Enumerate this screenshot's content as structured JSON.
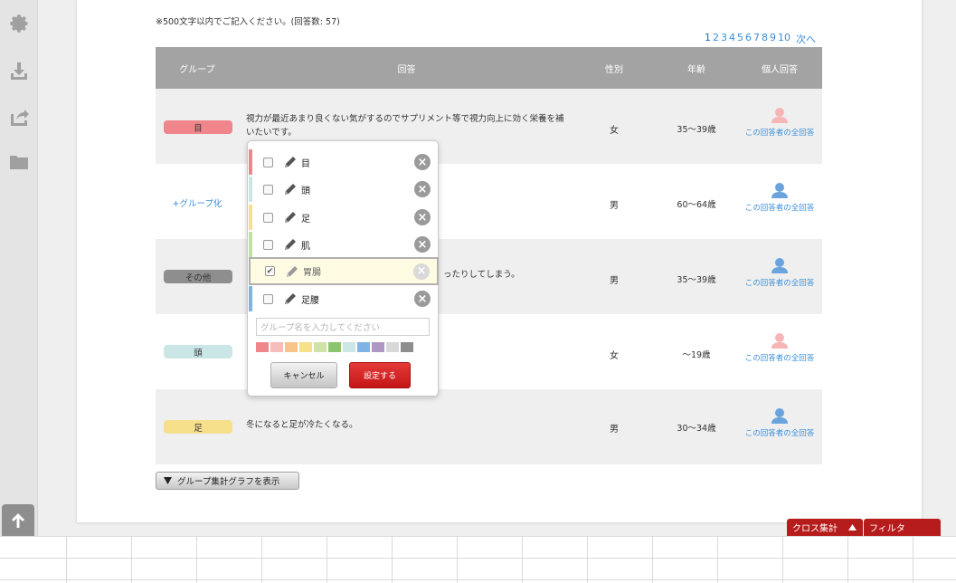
{
  "sidebar": {
    "icons": [
      "gear-icon",
      "download-icon",
      "share-icon",
      "folder-icon"
    ],
    "scroll_top_icon": "arrow-up-icon"
  },
  "note": "※500文字以内でご記入ください。(回答数: 57)",
  "pagination": {
    "pages": [
      "1",
      "2",
      "3",
      "4",
      "5",
      "6",
      "7",
      "8",
      "9",
      "10"
    ],
    "current": "1",
    "next": "次へ"
  },
  "table": {
    "headers": {
      "group": "グループ",
      "answer": "回答",
      "sex": "性別",
      "age": "年齢",
      "personal": "個人回答"
    },
    "rows": [
      {
        "group": "目",
        "group_color": "#f0868b",
        "answer": "視力が最近あまり良くない気がするのでサプリメント等で視力向上に効く栄養を補いたいです。",
        "sex": "女",
        "age": "35～39歳",
        "person_link": "この回答者の全回答",
        "avatar_color": "#f7b5b5"
      },
      {
        "group": "+グループ化",
        "group_color": "",
        "answer": "",
        "sex": "男",
        "age": "60～64歳",
        "person_link": "この回答者の全回答",
        "avatar_color": "#6aa3dd"
      },
      {
        "group": "その他",
        "group_color": "#8e8e8e",
        "answer": "ったりしてしまう。",
        "sex": "男",
        "age": "35～39歳",
        "person_link": "この回答者の全回答",
        "avatar_color": "#6aa3dd"
      },
      {
        "group": "頭",
        "group_color": "#cbe6e6",
        "answer": "",
        "sex": "女",
        "age": "～19歳",
        "person_link": "この回答者の全回答",
        "avatar_color": "#f7b5b5"
      },
      {
        "group": "足",
        "group_color": "#f6e08c",
        "answer": "冬になると足が冷たくなる。",
        "sex": "男",
        "age": "30～34歳",
        "person_link": "この回答者の全回答",
        "avatar_color": "#6aa3dd"
      }
    ]
  },
  "graph_button": "グループ集計グラフを表示",
  "popup": {
    "groups": [
      {
        "name": "目",
        "color": "#f0868b",
        "checked": false
      },
      {
        "name": "頭",
        "color": "#cbe6e6",
        "checked": false
      },
      {
        "name": "足",
        "color": "#f6e08c",
        "checked": false
      },
      {
        "name": "肌",
        "color": "#bfe0a8",
        "checked": false
      },
      {
        "name": "胃腸",
        "color": "#c4d98c",
        "checked": true
      },
      {
        "name": "足腰",
        "color": "#7fb2e5",
        "checked": false
      }
    ],
    "input_placeholder": "グループ名を入力してください",
    "swatches": [
      "#f0868b",
      "#f7bcbc",
      "#f8c38b",
      "#f6e08c",
      "#cfe3a6",
      "#8cc56e",
      "#cbe6e6",
      "#7fb2e5",
      "#ae97c3",
      "#d8d8d8",
      "#8e8e8e"
    ],
    "cancel": "キャンセル",
    "ok": "設定する"
  },
  "bottom_tabs": {
    "cross": "クロス集計",
    "filter": "フィルタ"
  }
}
